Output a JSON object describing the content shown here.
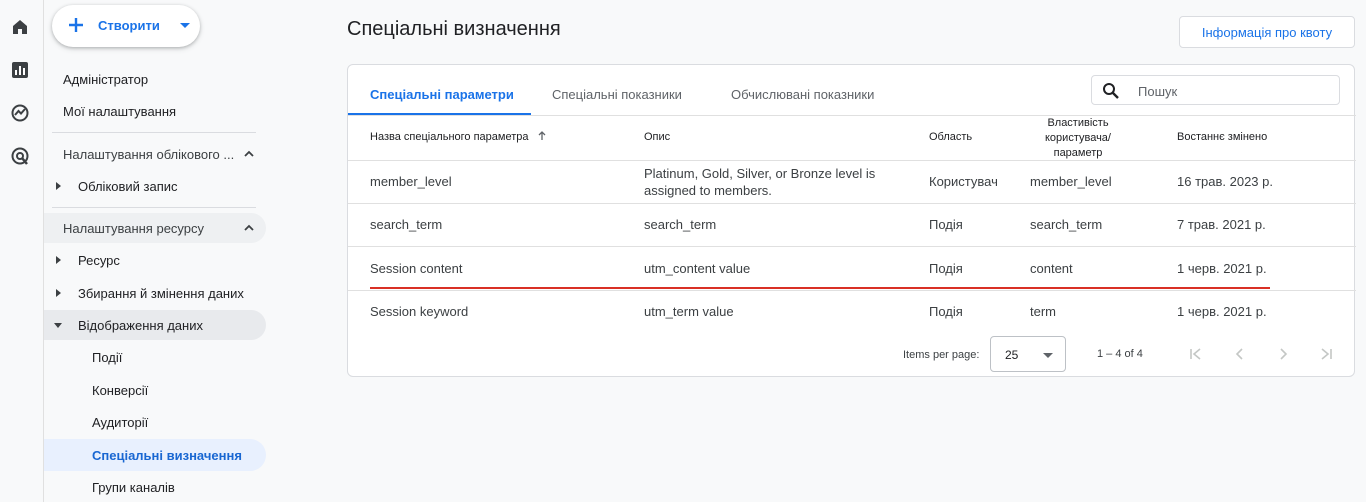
{
  "create_button": {
    "label": "Створити"
  },
  "sidebar": {
    "admin": "Адміністратор",
    "my_settings": "Мої налаштування",
    "account_settings": "Налаштування облікового ...",
    "account": "Обліковий запис",
    "property_settings": "Налаштування ресурсу",
    "property": "Ресурс",
    "data_collection": "Збирання й змінення даних",
    "data_display": "Відображення даних",
    "events": "Події",
    "conversions": "Конверсії",
    "audiences": "Аудиторії",
    "custom_definitions": "Спеціальні визначення",
    "channel_groups": "Групи каналів"
  },
  "header": {
    "title": "Спеціальні визначення",
    "quota_button": "Інформація про квоту"
  },
  "tabs": [
    "Спеціальні параметри",
    "Спеціальні показники",
    "Обчислювані показники"
  ],
  "search": {
    "placeholder": "Пошук",
    "value": ""
  },
  "table": {
    "columns": {
      "name": "Назва спеціального параметра",
      "description": "Опис",
      "scope": "Область",
      "user_property_line1": "Властивість",
      "user_property_line2": "користувача/",
      "user_property_line3": "параметр",
      "last_changed": "Востаннє змінено"
    },
    "rows": [
      {
        "name": "member_level",
        "description": "Platinum, Gold, Silver, or Bronze level is assigned to members.",
        "scope": "Користувач",
        "param": "member_level",
        "changed": "16 трав. 2023 р."
      },
      {
        "name": "search_term",
        "description": "search_term",
        "scope": "Подія",
        "param": "search_term",
        "changed": "7 трав. 2021 р."
      },
      {
        "name": "Session content",
        "description": "utm_content value",
        "scope": "Подія",
        "param": "content",
        "changed": "1 черв. 2021 р."
      },
      {
        "name": "Session keyword",
        "description": "utm_term value",
        "scope": "Подія",
        "param": "term",
        "changed": "1 черв. 2021 р."
      }
    ]
  },
  "pagination": {
    "items_per_page_label": "Items per page:",
    "items_per_page_value": "25",
    "range": "1 – 4 of 4"
  },
  "colors": {
    "accent": "#1a73e8",
    "highlight_line": "#d93025"
  }
}
